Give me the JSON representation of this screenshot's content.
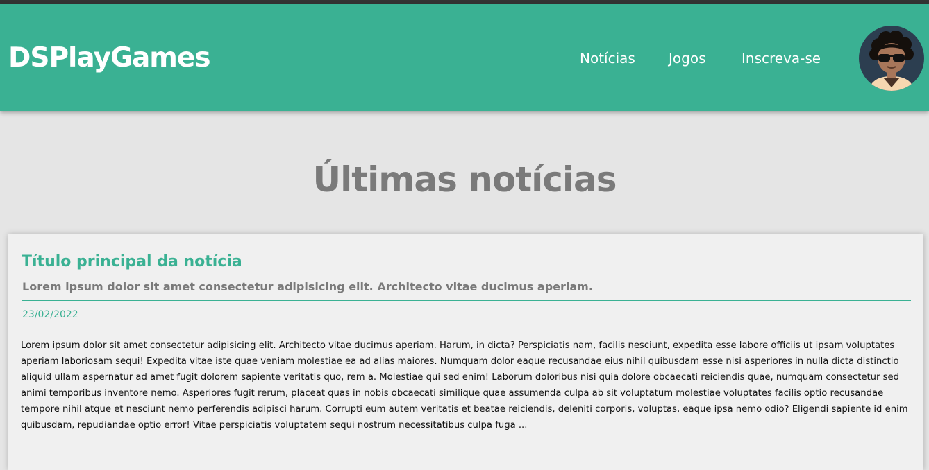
{
  "header": {
    "brand": "DSPlayGames",
    "nav": {
      "noticias": "Notícias",
      "jogos": "Jogos",
      "inscreva": "Inscreva-se"
    },
    "avatar_icon": "user-avatar-icon"
  },
  "main": {
    "page_title": "Últimas notícias",
    "article": {
      "title": "Título principal da notícia",
      "subtitle": "Lorem ipsum dolor sit amet consectetur adipisicing elit. Architecto vitae ducimus aperiam.",
      "date": "23/02/2022",
      "body": "Lorem ipsum dolor sit amet consectetur adipisicing elit. Architecto vitae ducimus aperiam. Harum, in dicta? Perspiciatis nam, facilis nesciunt, expedita esse labore officiis ut ipsam voluptates aperiam laboriosam sequi! Expedita vitae iste quae veniam molestiae ea ad alias maiores. Numquam dolor eaque recusandae eius nihil quibusdam esse nisi asperiores in nulla dicta distinctio aliquid ullam aspernatur ad amet fugit dolorem sapiente veritatis quo, rem a. Molestiae qui sed enim! Laborum doloribus nisi quia dolore obcaecati reiciendis quae, numquam consectetur sed animi temporibus inventore nemo. Asperiores fugit rerum, placeat quas in nobis obcaecati similique quae assumenda culpa ab sit voluptatum molestiae voluptates facilis optio recusandae tempore nihil atque et nesciunt nemo perferendis adipisci harum. Corrupti eum autem veritatis et beatae reiciendis, deleniti corporis, voluptas, eaque ipsa nemo odio? Eligendi sapiente id enim quibusdam, repudiandae optio error! Vitae perspiciatis voluptatem sequi nostrum necessitatibus culpa fuga ..."
    }
  },
  "colors": {
    "accent": "#3ab193",
    "top_strip": "#333333",
    "page_bg": "#e5e5e5",
    "card_bg": "#f0f0f0",
    "heading_gray": "#7a7a7a",
    "body_text": "#111111"
  }
}
